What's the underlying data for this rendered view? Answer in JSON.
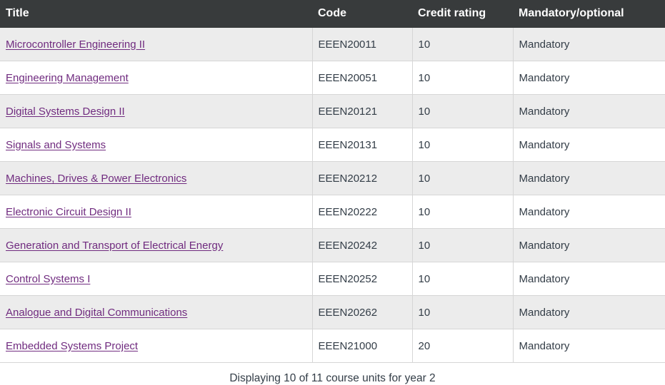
{
  "table": {
    "columns": [
      {
        "key": "title",
        "label": "Title"
      },
      {
        "key": "code",
        "label": "Code"
      },
      {
        "key": "credit",
        "label": "Credit rating"
      },
      {
        "key": "mandatory",
        "label": "Mandatory/optional"
      }
    ],
    "rows": [
      {
        "title": "Microcontroller Engineering II",
        "code": "EEEN20011",
        "credit": "10",
        "mandatory": "Mandatory"
      },
      {
        "title": "Engineering Management",
        "code": "EEEN20051",
        "credit": "10",
        "mandatory": "Mandatory"
      },
      {
        "title": "Digital Systems Design II",
        "code": "EEEN20121",
        "credit": "10",
        "mandatory": "Mandatory"
      },
      {
        "title": "Signals and Systems",
        "code": "EEEN20131",
        "credit": "10",
        "mandatory": "Mandatory"
      },
      {
        "title": "Machines, Drives & Power Electronics",
        "code": "EEEN20212",
        "credit": "10",
        "mandatory": "Mandatory"
      },
      {
        "title": "Electronic Circuit Design II",
        "code": "EEEN20222",
        "credit": "10",
        "mandatory": "Mandatory"
      },
      {
        "title": "Generation and Transport of Electrical Energy",
        "code": "EEEN20242",
        "credit": "10",
        "mandatory": "Mandatory"
      },
      {
        "title": "Control Systems I",
        "code": "EEEN20252",
        "credit": "10",
        "mandatory": "Mandatory"
      },
      {
        "title": "Analogue and Digital Communications",
        "code": "EEEN20262",
        "credit": "10",
        "mandatory": "Mandatory"
      },
      {
        "title": "Embedded Systems Project",
        "code": "EEEN21000",
        "credit": "20",
        "mandatory": "Mandatory"
      }
    ],
    "caption": "Displaying 10 of 11 course units for year 2"
  },
  "colors": {
    "header_background": "#383b3c",
    "header_text": "#ffffff",
    "link": "#702b7f",
    "body_text": "#333d47",
    "row_odd": "#ececec",
    "row_even": "#ffffff",
    "border": "#d6d6d6"
  }
}
